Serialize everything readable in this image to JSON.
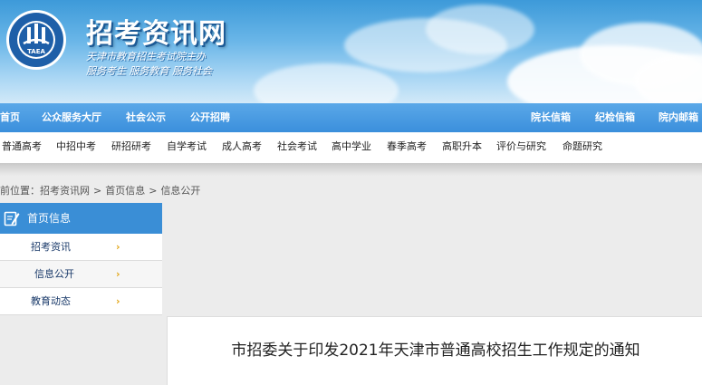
{
  "header": {
    "site_title": "招考资讯网",
    "slogan_line1": "天津市教育招生考试院主办",
    "slogan_line2": "服务考生 服务教育 服务社会",
    "logo_text": "TAEA"
  },
  "main_nav": {
    "items": [
      {
        "label": "首页"
      },
      {
        "label": "公众服务大厅"
      },
      {
        "label": "社会公示"
      },
      {
        "label": "公开招聘"
      },
      {
        "label": "院长信箱"
      },
      {
        "label": "纪检信箱"
      },
      {
        "label": "院内邮箱"
      }
    ]
  },
  "sub_nav": {
    "items": [
      {
        "label": "普通高考"
      },
      {
        "label": "中招中考"
      },
      {
        "label": "研招研考"
      },
      {
        "label": "自学考试"
      },
      {
        "label": "成人高考"
      },
      {
        "label": "社会考试"
      },
      {
        "label": "高中学业"
      },
      {
        "label": "春季高考"
      },
      {
        "label": "高职升本"
      },
      {
        "label": "评价与研究"
      },
      {
        "label": "命题研究"
      }
    ]
  },
  "breadcrumb": {
    "prefix": "前位置：",
    "items": [
      {
        "label": "招考资讯网"
      },
      {
        "label": "首页信息"
      },
      {
        "label": "信息公开"
      }
    ],
    "separator": ">"
  },
  "sidebar": {
    "title": "首页信息",
    "chevron": "›",
    "items": [
      {
        "label": "招考资讯"
      },
      {
        "label": "信息公开"
      },
      {
        "label": "教育动态"
      }
    ]
  },
  "article": {
    "title": "市招委关于印发2021年天津市普通高校招生工作规定的通知"
  },
  "colors": {
    "nav_blue": "#3b8fdc",
    "sidebar_head": "#3a8ed6",
    "chevron": "#e2a514"
  }
}
